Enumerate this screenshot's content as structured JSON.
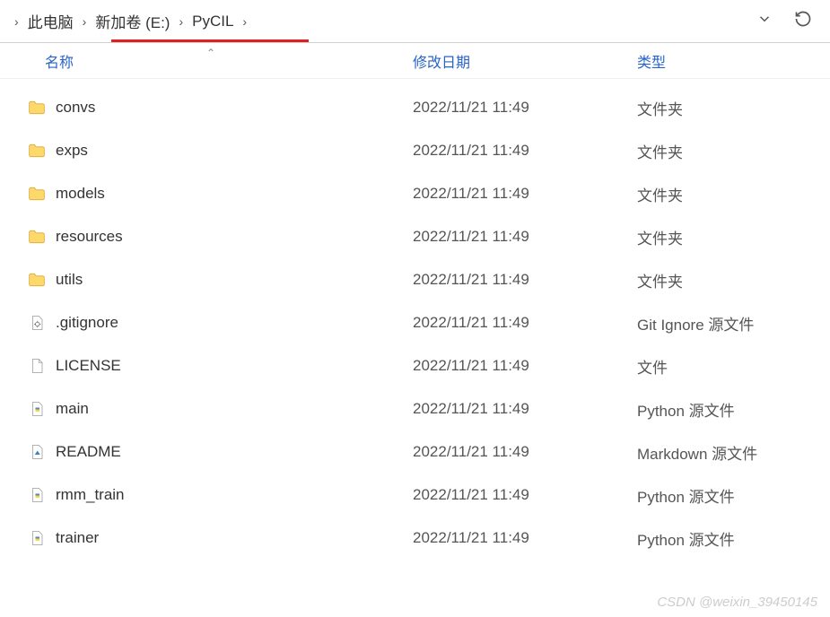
{
  "breadcrumbs": [
    "此电脑",
    "新加卷 (E:)",
    "PyCIL"
  ],
  "columns": {
    "name": "名称",
    "date": "修改日期",
    "type": "类型"
  },
  "items": [
    {
      "name": "convs",
      "date": "2022/11/21 11:49",
      "type": "文件夹",
      "icon": "folder"
    },
    {
      "name": "exps",
      "date": "2022/11/21 11:49",
      "type": "文件夹",
      "icon": "folder"
    },
    {
      "name": "models",
      "date": "2022/11/21 11:49",
      "type": "文件夹",
      "icon": "folder"
    },
    {
      "name": "resources",
      "date": "2022/11/21 11:49",
      "type": "文件夹",
      "icon": "folder"
    },
    {
      "name": "utils",
      "date": "2022/11/21 11:49",
      "type": "文件夹",
      "icon": "folder"
    },
    {
      "name": ".gitignore",
      "date": "2022/11/21 11:49",
      "type": "Git Ignore 源文件",
      "icon": "gear"
    },
    {
      "name": "LICENSE",
      "date": "2022/11/21 11:49",
      "type": "文件",
      "icon": "blank"
    },
    {
      "name": "main",
      "date": "2022/11/21 11:49",
      "type": "Python 源文件",
      "icon": "py"
    },
    {
      "name": "README",
      "date": "2022/11/21 11:49",
      "type": "Markdown 源文件",
      "icon": "md"
    },
    {
      "name": "rmm_train",
      "date": "2022/11/21 11:49",
      "type": "Python 源文件",
      "icon": "py"
    },
    {
      "name": "trainer",
      "date": "2022/11/21 11:49",
      "type": "Python 源文件",
      "icon": "py"
    }
  ],
  "watermark": "CSDN @weixin_39450145"
}
